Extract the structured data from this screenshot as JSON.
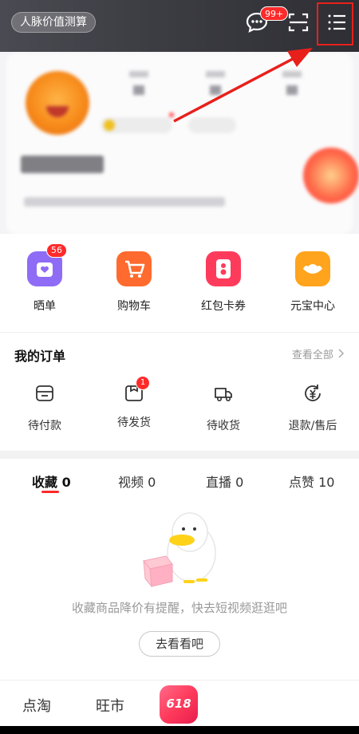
{
  "header": {
    "net_value_label": "人脉价值测算",
    "message_badge": "99+"
  },
  "quick_actions": [
    {
      "label": "晒单",
      "badge": "56",
      "color": "#8f6cf5"
    },
    {
      "label": "购物车",
      "color": "#ff6a2e"
    },
    {
      "label": "红包卡券",
      "color": "#ff3b5c"
    },
    {
      "label": "元宝中心",
      "color": "#ffa41c"
    }
  ],
  "orders": {
    "title": "我的订单",
    "view_all": "查看全部",
    "items": [
      {
        "label": "待付款"
      },
      {
        "label": "待发货",
        "badge": "1"
      },
      {
        "label": "待收货"
      },
      {
        "label": "退款/售后"
      }
    ]
  },
  "tabs": [
    {
      "label": "收藏",
      "count": "0",
      "active": true
    },
    {
      "label": "视频",
      "count": "0"
    },
    {
      "label": "直播",
      "count": "0"
    },
    {
      "label": "点赞",
      "count": "10"
    }
  ],
  "empty_state": {
    "message": "收藏商品降价有提醒，快去短视频逛逛吧",
    "button": "去看看吧"
  },
  "bottom_bar": {
    "item1": "点淘",
    "item2": "旺市",
    "badge_text": "618"
  },
  "colors": {
    "accent": "#ff2a2a",
    "highlight": "#e8201b"
  }
}
